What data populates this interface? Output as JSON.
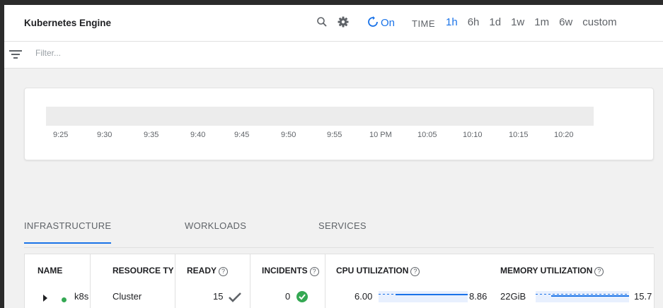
{
  "header": {
    "title": "Kubernetes Engine",
    "refresh_label": "On",
    "time_label": "TIME",
    "ranges": [
      {
        "label": "1h",
        "active": true
      },
      {
        "label": "6h",
        "active": false
      },
      {
        "label": "1d",
        "active": false
      },
      {
        "label": "1w",
        "active": false
      },
      {
        "label": "1m",
        "active": false
      },
      {
        "label": "6w",
        "active": false
      },
      {
        "label": "custom",
        "active": false
      }
    ]
  },
  "filter": {
    "placeholder": "Filter..."
  },
  "timeline": {
    "ticks": [
      "9:25",
      "9:30",
      "9:35",
      "9:40",
      "9:45",
      "9:50",
      "9:55",
      "10 PM",
      "10:05",
      "10:10",
      "10:15",
      "10:20"
    ]
  },
  "tabs": [
    {
      "label": "INFRASTRUCTURE",
      "active": true
    },
    {
      "label": "WORKLOADS",
      "active": false
    },
    {
      "label": "SERVICES",
      "active": false
    }
  ],
  "table": {
    "columns": {
      "name": "NAME",
      "resource_type": "RESOURCE TYPE",
      "ready": "READY",
      "incidents": "INCIDENTS",
      "cpu": "CPU UTILIZATION",
      "memory": "MEMORY UTILIZATION"
    },
    "rows": [
      {
        "name": "k8s",
        "resource_type": "Cluster",
        "ready": "15",
        "incidents": "0",
        "cpu_min": "6.00",
        "cpu_max": "8.86",
        "mem_min": "22GiB",
        "mem_max": "15.7"
      }
    ]
  },
  "colors": {
    "accent": "#1a73e8",
    "ok": "#34a853"
  }
}
